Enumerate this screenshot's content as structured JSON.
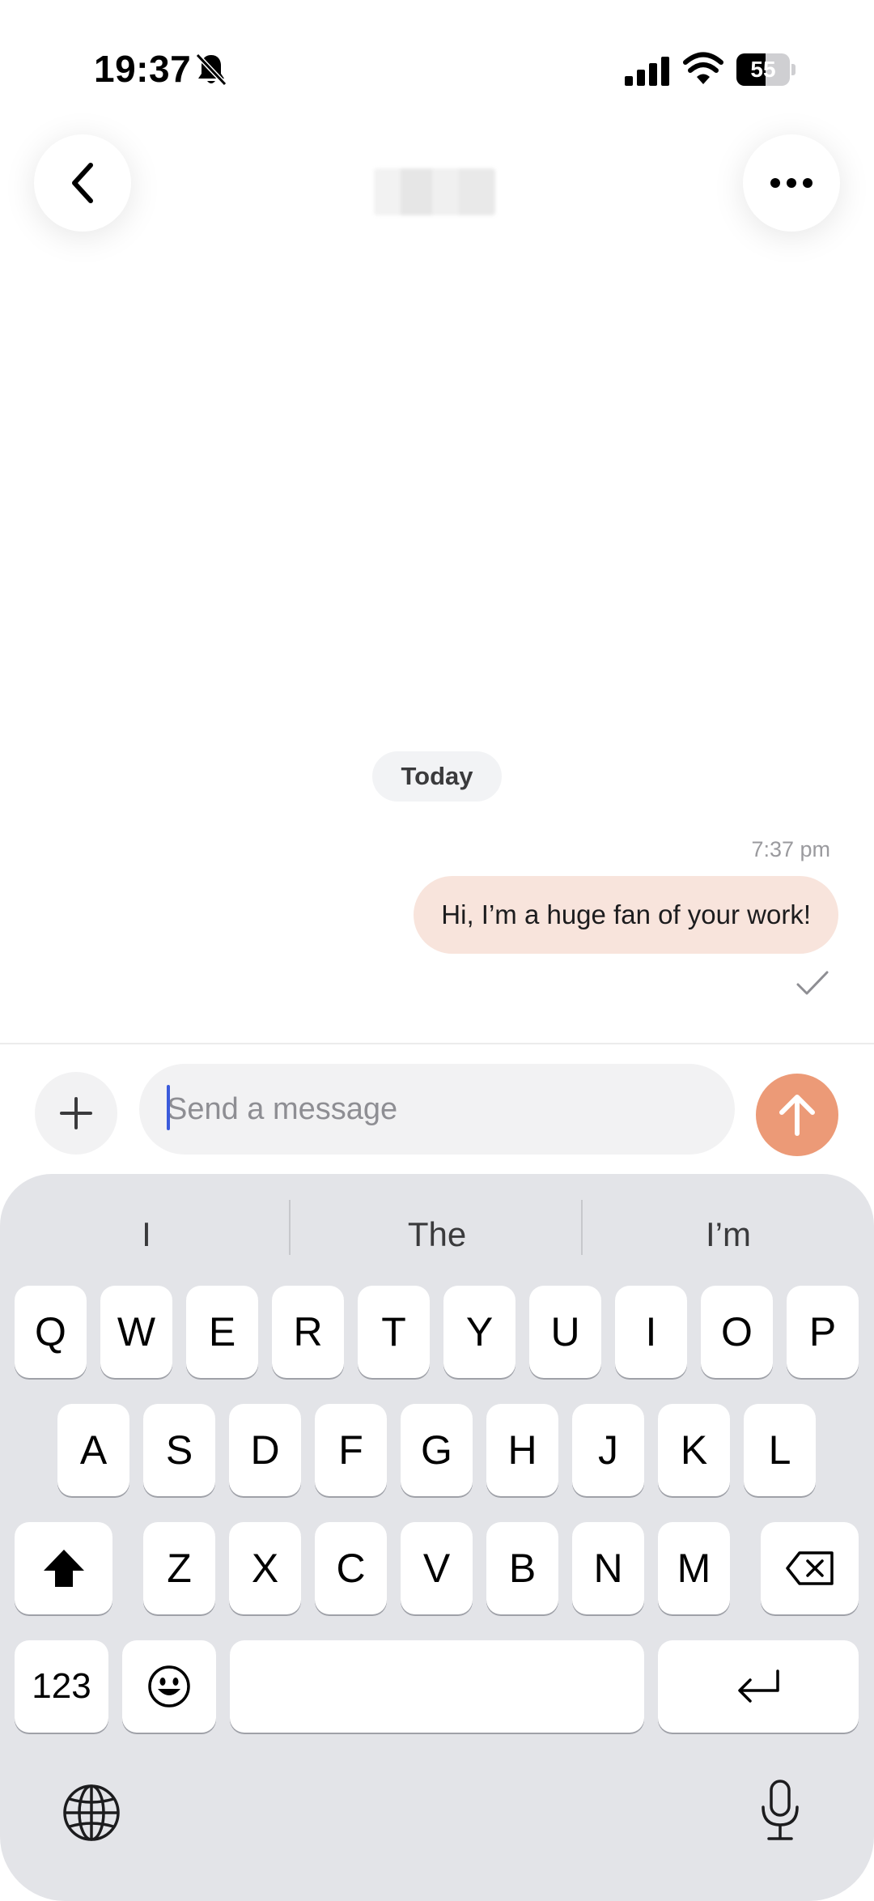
{
  "status_bar": {
    "time": "19:37",
    "battery_percent": "55",
    "battery_level": 0.55,
    "icons": [
      "bell-slash-icon",
      "cellular-signal-icon",
      "wifi-icon",
      "battery-icon"
    ]
  },
  "header": {
    "back_icon": "chevron-left-icon",
    "more_icon": "ellipsis-icon"
  },
  "chat": {
    "date_label": "Today",
    "messages": [
      {
        "time": "7:37 pm",
        "text": "Hi, I’m a huge fan of your work!",
        "direction": "outgoing",
        "status_icon": "checkmark-icon"
      }
    ]
  },
  "composer": {
    "placeholder": "Send a message",
    "add_icon": "plus-icon",
    "send_icon": "arrow-up-icon"
  },
  "colors": {
    "outgoing_bubble": "#f8e4dc",
    "send_button": "#ec9a77",
    "input_background": "#f2f2f3",
    "keyboard_background": "#e3e4e8",
    "caret": "#3b5bdb"
  },
  "keyboard": {
    "suggestions": [
      "I",
      "The",
      "I’m"
    ],
    "row1": [
      "Q",
      "W",
      "E",
      "R",
      "T",
      "Y",
      "U",
      "I",
      "O",
      "P"
    ],
    "row2": [
      "A",
      "S",
      "D",
      "F",
      "G",
      "H",
      "J",
      "K",
      "L"
    ],
    "row3": [
      "Z",
      "X",
      "C",
      "V",
      "B",
      "N",
      "M"
    ],
    "numbers_label": "123",
    "icons": [
      "shift-icon",
      "backspace-icon",
      "emoji-icon",
      "return-icon",
      "globe-icon",
      "microphone-icon"
    ]
  }
}
